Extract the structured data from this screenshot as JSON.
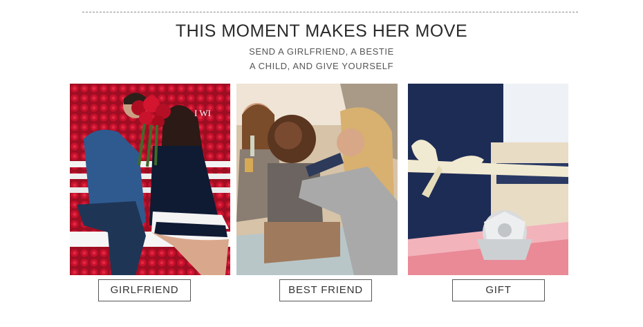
{
  "header": {
    "title": "THIS MOMENT MAKES HER MOVE",
    "subtitle_line1": "SEND A GIRLFRIEND, A BESTIE",
    "subtitle_line2": "A CHILD, AND GIVE YOURSELF"
  },
  "cards": [
    {
      "label": "GIRLFRIEND",
      "image_overlay_text": "I WI"
    },
    {
      "label": "BEST FRIEND"
    },
    {
      "label": "GIFT"
    }
  ],
  "colors": {
    "rose_red": "#c8102e",
    "suit_blue": "#2f5a8f",
    "gift_navy": "#1d2c55",
    "ribbon_cream": "#f1ead2",
    "bow_silver": "#d9dbdd",
    "gift_pink": "#e98a96"
  }
}
